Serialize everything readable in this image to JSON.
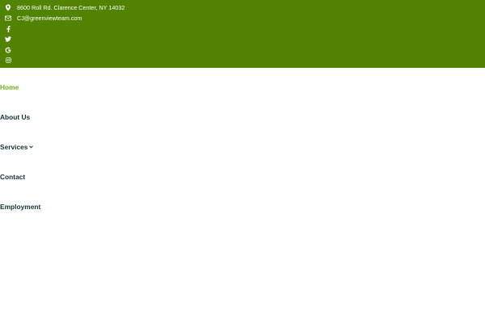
{
  "topbar": {
    "background": "#518200",
    "address": "8600 Roll Rd. Clarence Center, NY 14032",
    "email": "CJ@greenviewteam.com",
    "social": [
      {
        "icon": "facebook-icon"
      },
      {
        "icon": "twitter-icon"
      },
      {
        "icon": "google-icon"
      },
      {
        "icon": "instagram-icon"
      }
    ]
  },
  "nav": {
    "active_color": "#73ad1f",
    "text_color": "#14323a",
    "items": [
      {
        "label": "Home",
        "active": true
      },
      {
        "label": "About Us"
      },
      {
        "label": "Services",
        "has_dropdown": true
      },
      {
        "label": "Contact"
      },
      {
        "label": "Employment"
      }
    ]
  }
}
